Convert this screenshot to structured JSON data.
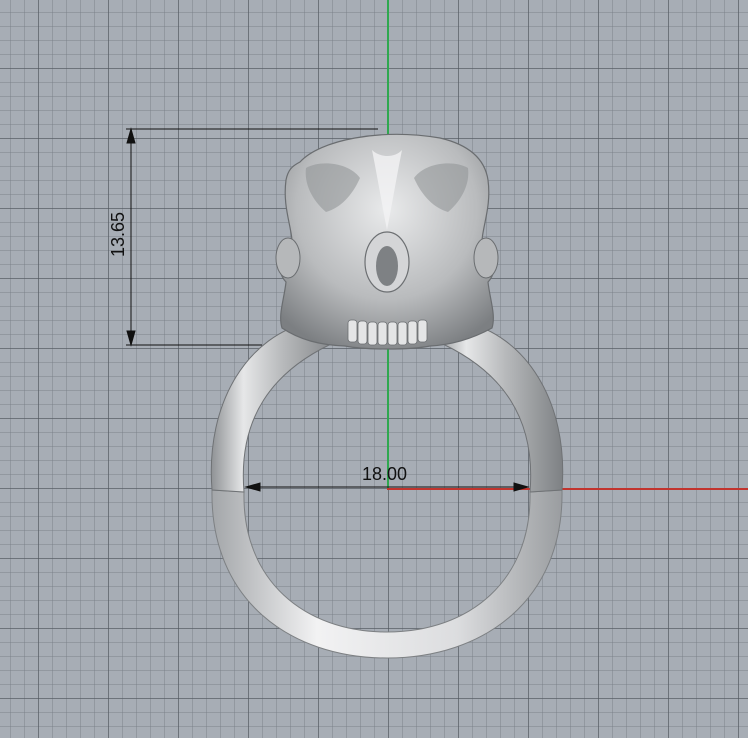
{
  "viewport": {
    "background_color": "#a7adb5",
    "axis_colors": {
      "y_axis": "#2fa84f",
      "x_axis": "#c2342e"
    }
  },
  "model": {
    "icon": "skull-ring-model",
    "color": "#c9cbcd"
  },
  "dimensions": {
    "width_value": "18.00",
    "height_value": "13.65"
  }
}
